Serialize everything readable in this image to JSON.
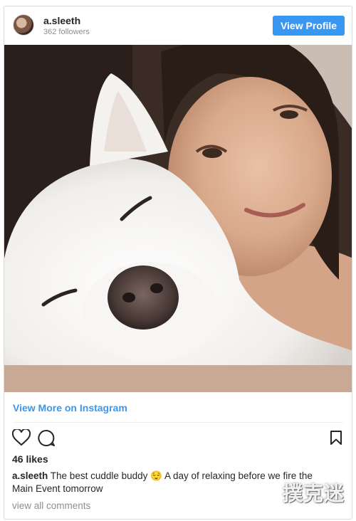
{
  "header": {
    "username": "a.sleeth",
    "followers": "362 followers",
    "view_profile_label": "View Profile"
  },
  "post": {
    "view_more_label": "View More on Instagram",
    "likes": "46 likes",
    "caption_user": "a.sleeth",
    "caption_text": "The best cuddle buddy 😌 A day of relaxing before we fire the Main Event tomorrow",
    "view_comments_label": "view all comments"
  },
  "icons": [
    "heart-icon",
    "comment-icon",
    "bookmark-icon"
  ],
  "watermark": {
    "text": "撲克迷"
  },
  "colors": {
    "accent": "#3897f0",
    "text": "#262626",
    "muted": "#8e8e8e"
  }
}
